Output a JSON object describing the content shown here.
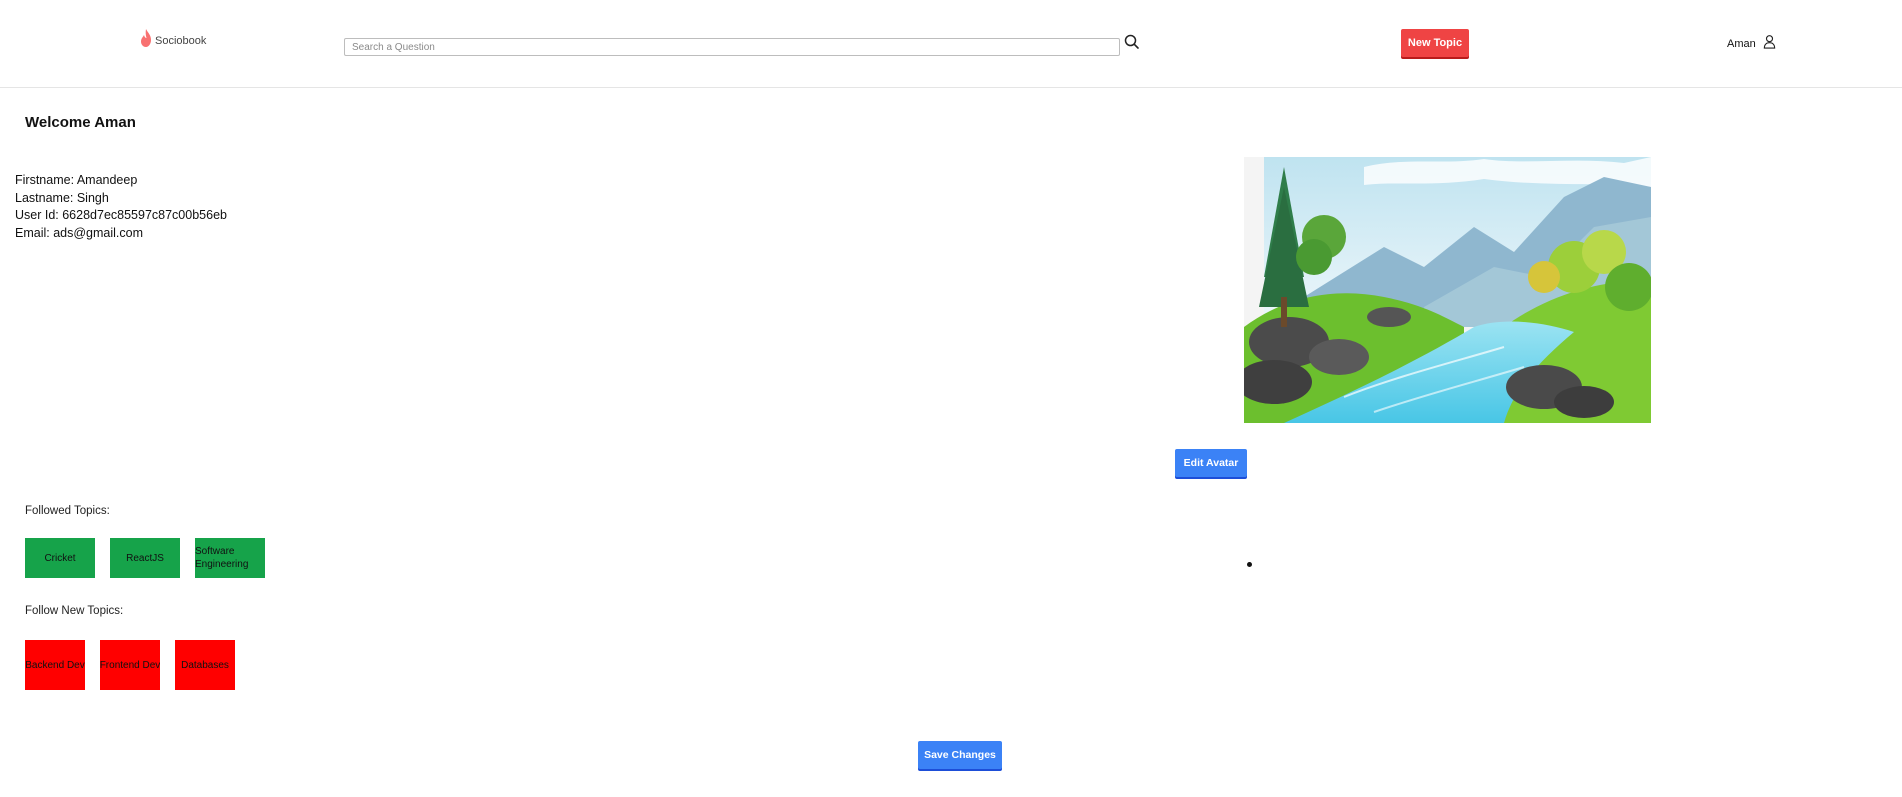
{
  "header": {
    "logo_text": "Sociobook",
    "logo_icon": "flame-icon",
    "search_placeholder": "Search a Question",
    "search_value": "",
    "search_icon": "search-icon",
    "new_topic_label": "New Topic",
    "user_name": "Aman",
    "user_icon": "user-icon"
  },
  "profile": {
    "welcome": "Welcome Aman",
    "firstname": "Firstname: Amandeep",
    "lastname": "Lastname: Singh",
    "user_id": "User Id: 6628d7ec85597c87c00b56eb",
    "email": "Email: ads@gmail.com"
  },
  "avatar": {
    "edit_label": "Edit Avatar"
  },
  "topics": {
    "followed_label": "Followed Topics:",
    "followed": [
      "Cricket",
      "ReactJS",
      "Software Engineering"
    ],
    "new_label": "Follow New Topics:",
    "new": [
      "Backend Dev",
      "Frontend Dev",
      "Databases"
    ]
  },
  "actions": {
    "save_label": "Save Changes"
  },
  "colors": {
    "primary_blue": "#3b82f6",
    "danger_red": "#ef4444",
    "followed_green": "#16a34a",
    "new_topic_red": "#ff0000"
  }
}
